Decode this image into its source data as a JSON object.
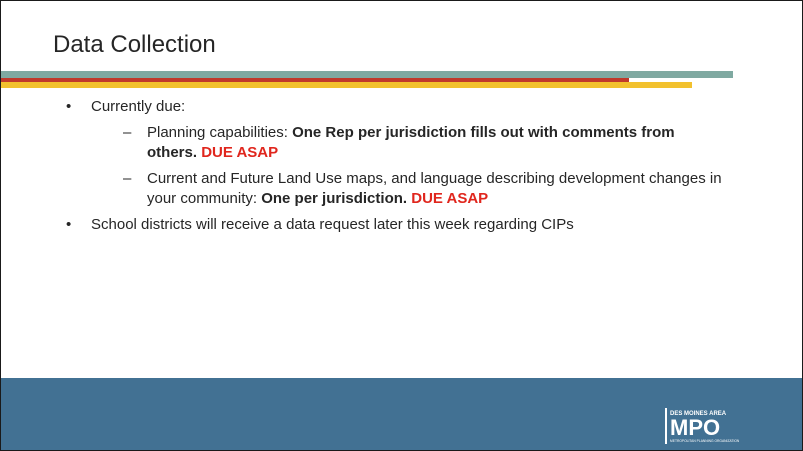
{
  "slide": {
    "title": "Data Collection",
    "bullets": [
      {
        "text": "Currently due:",
        "subitems": [
          {
            "text": "Planning capabilities: ",
            "bold": "One Rep per jurisdiction fills out with comments from others.",
            "due": "DUE ASAP"
          },
          {
            "text": "Current and Future Land Use maps, and language describing development changes in your community: ",
            "bold": "One per jurisdiction.",
            "due": "DUE ASAP"
          }
        ]
      },
      {
        "text": "School districts will receive a data request later this week regarding CIPs"
      }
    ]
  },
  "logo": {
    "top_text": "DES MOINES AREA",
    "main_text": "MPO",
    "bottom_text": "METROPOLITAN PLANNING ORGANIZATION"
  },
  "colors": {
    "stripe_teal": "#7fa9a1",
    "stripe_red": "#c0392b",
    "stripe_gold": "#f2c12e",
    "footer": "#427193",
    "due": "#e0261d"
  }
}
